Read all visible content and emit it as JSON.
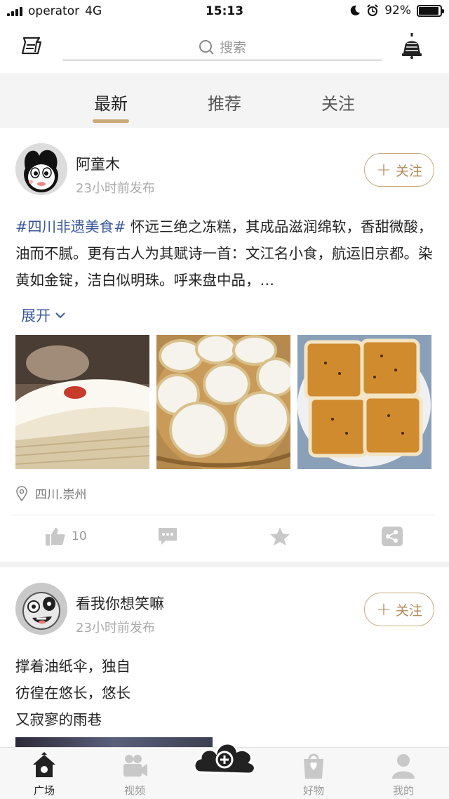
{
  "status_bar": {
    "carrier": "operator",
    "network": "4G",
    "time": "15:13",
    "battery": "92%",
    "battery_level": 0.92,
    "icons": [
      "moon-icon",
      "alarm-icon",
      "battery-icon"
    ]
  },
  "header": {
    "left_icon": "scroll-icon",
    "search_placeholder": "搜索",
    "right_icon": "bell-icon"
  },
  "tabs": [
    {
      "label": "最新",
      "active": true
    },
    {
      "label": "推荐",
      "active": false
    },
    {
      "label": "关注",
      "active": false
    }
  ],
  "posts": [
    {
      "username": "阿童木",
      "time": "23小时前发布",
      "follow_label": "关注",
      "hashtag": "#四川非遗美食#",
      "text": " 怀远三绝之冻糕，其成品滋润绵软，香甜微酸，油而不腻。更有古人为其赋诗一首：文江名小食，航运旧京都。染黄如金锭，洁白似明珠。呼来盘中品，…",
      "expand_label": "展开",
      "photos": [
        "steamed-cake-with-goji-photo",
        "white-rice-cakes-in-steamer-photo",
        "brown-sesame-cakes-photo"
      ],
      "location": "四川.崇州",
      "likes": "10",
      "action_icons": [
        "like-icon",
        "comment-icon",
        "favorite-icon",
        "share-icon"
      ]
    },
    {
      "username": "看我你想笑嘛",
      "time": "23小时前发布",
      "follow_label": "关注",
      "lines": [
        "撑着油纸伞，独自",
        "彷徨在悠长，悠长",
        "又寂寥的雨巷"
      ]
    }
  ],
  "bottom_nav": [
    {
      "label": "广场",
      "icon": "house-icon",
      "active": true
    },
    {
      "label": "视频",
      "icon": "video-camera-icon",
      "active": false
    },
    {
      "label": "好物",
      "icon": "gift-bag-icon",
      "active": false
    },
    {
      "label": "我的",
      "icon": "user-icon",
      "active": false
    }
  ],
  "fab_icon": "add-cloud-icon",
  "colors": {
    "accent_gold": "#c9a97a",
    "follow_text": "#b08a58",
    "link_blue": "#3b5998",
    "muted_gray": "#aaaaaa"
  }
}
